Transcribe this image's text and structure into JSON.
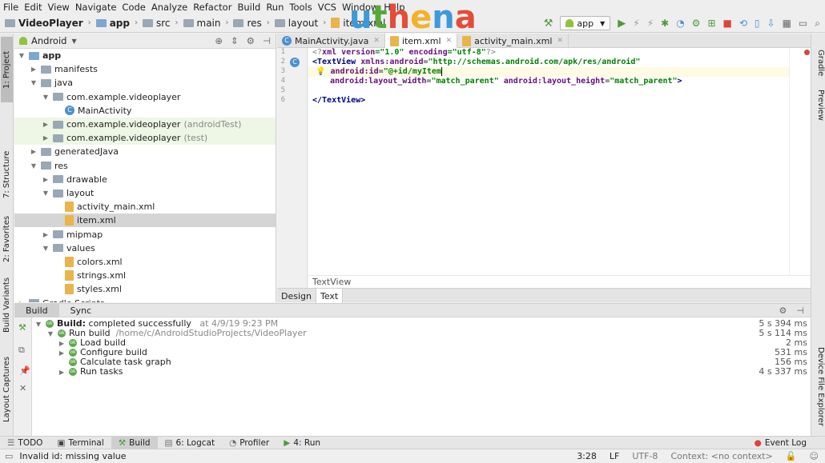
{
  "menu": [
    "File",
    "Edit",
    "View",
    "Navigate",
    "Code",
    "Analyze",
    "Refactor",
    "Build",
    "Run",
    "Tools",
    "VCS",
    "Window",
    "Help"
  ],
  "breadcrumb": {
    "project": "VideoPlayer",
    "module": "app",
    "src": "src",
    "main": "main",
    "res": "res",
    "layout": "layout",
    "file": "item.xml"
  },
  "logo": {
    "u": "u",
    "t": "t",
    "h": "h",
    "e": "e",
    "n": "n",
    "a": "a"
  },
  "toolbar": {
    "run_config": "app"
  },
  "colors": {
    "logo_u": "#3b9ad9",
    "logo_t": "#5aa63a",
    "logo_h": "#e34c3b",
    "logo_e": "#f1b22c",
    "logo_n": "#3b9ad9",
    "logo_a": "#e34c3b"
  },
  "left_tools": {
    "project": "1: Project",
    "structure": "7: Structure",
    "favorites": "2: Favorites",
    "build_variants": "Build Variants",
    "layout_captures": "Layout Captures"
  },
  "right_tools": {
    "gradle": "Gradle",
    "preview": "Preview",
    "device_file": "Device File Explorer"
  },
  "project_panel": {
    "view": "Android"
  },
  "tree": [
    {
      "label": "app",
      "indent": 0,
      "type": "folder"
    },
    {
      "label": "manifests",
      "indent": 1,
      "type": "folder"
    },
    {
      "label": "java",
      "indent": 1,
      "type": "folder"
    },
    {
      "label": "com.example.videoplayer",
      "indent": 2,
      "type": "folder"
    },
    {
      "label": "MainActivity",
      "indent": 3,
      "type": "class"
    },
    {
      "label": "com.example.videoplayer",
      "suffix": "(androidTest)",
      "indent": 2,
      "type": "folder"
    },
    {
      "label": "com.example.videoplayer",
      "suffix": "(test)",
      "indent": 2,
      "type": "folder"
    },
    {
      "label": "generatedJava",
      "indent": 1,
      "type": "folder"
    },
    {
      "label": "res",
      "indent": 1,
      "type": "folder"
    },
    {
      "label": "drawable",
      "indent": 2,
      "type": "folder"
    },
    {
      "label": "layout",
      "indent": 2,
      "type": "folder"
    },
    {
      "label": "activity_main.xml",
      "indent": 3,
      "type": "xml"
    },
    {
      "label": "item.xml",
      "indent": 3,
      "type": "xml"
    },
    {
      "label": "mipmap",
      "indent": 2,
      "type": "folder"
    },
    {
      "label": "values",
      "indent": 2,
      "type": "folder"
    },
    {
      "label": "colors.xml",
      "indent": 3,
      "type": "xml"
    },
    {
      "label": "strings.xml",
      "indent": 3,
      "type": "xml"
    },
    {
      "label": "styles.xml",
      "indent": 3,
      "type": "xml"
    },
    {
      "label": "Gradle Scripts",
      "indent": 0,
      "type": "folder"
    }
  ],
  "editor_tabs": [
    {
      "label": "MainActivity.java",
      "icon": "class"
    },
    {
      "label": "item.xml",
      "icon": "xml"
    },
    {
      "label": "activity_main.xml",
      "icon": "xml"
    }
  ],
  "code": {
    "l1_a": "<?",
    "l1_b": "xml version",
    "l1_c": "=\"1.0\" ",
    "l1_d": "encoding",
    "l1_e": "=\"utf-8\"",
    "l1_f": "?>",
    "l2_a": "<TextView ",
    "l2_b": "xmlns:android",
    "l2_c": "=",
    "l2_d": "\"http://schemas.android.com/apk/res/android\"",
    "l3_a": "android:id",
    "l3_b": "=",
    "l3_c": "\"@+id/myItem",
    "l4_a": "android:layout_width",
    "l4_b": "=",
    "l4_c": "\"match_parent\" ",
    "l4_d": "android:layout_height",
    "l4_e": "=",
    "l4_f": "\"match_parent\"",
    "l4_g": ">",
    "l6": "</TextView>"
  },
  "line_numbers": [
    "1",
    "2",
    "3",
    "4",
    "5",
    "6"
  ],
  "editor_breadcrumb": "TextView",
  "design_tabs": [
    "Design",
    "Text"
  ],
  "build_tabs": [
    "Build",
    "Sync"
  ],
  "build": [
    {
      "label": "Build:",
      "rest": "completed successfully",
      "meta": "at 4/9/19 9:23 PM",
      "time": "5 s 394 ms"
    },
    {
      "label": "Run build",
      "meta": "/home/c/AndroidStudioProjects/VideoPlayer",
      "time": "5 s 114 ms"
    },
    {
      "label": "Load build",
      "time": "2 ms"
    },
    {
      "label": "Configure build",
      "time": "531 ms"
    },
    {
      "label": "Calculate task graph",
      "time": "156 ms"
    },
    {
      "label": "Run tasks",
      "time": "4 s 337 ms"
    }
  ],
  "bottom_tools": {
    "todo": "TODO",
    "terminal": "Terminal",
    "build": "Build",
    "logcat": "6: Logcat",
    "profiler": "Profiler",
    "run": "4: Run",
    "event_log": "Event Log"
  },
  "status": {
    "message": "Invalid id: missing value",
    "position": "3:28",
    "line_sep": "LF",
    "encoding": "UTF-8",
    "context": "Context: <no context>"
  }
}
